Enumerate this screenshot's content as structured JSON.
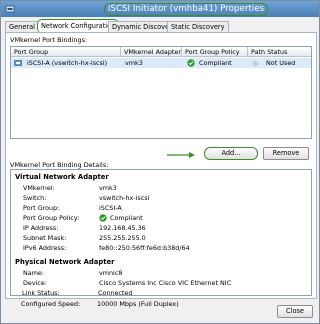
{
  "window": {
    "title": "iSCSI Initiator (vmhba41) Properties"
  },
  "tabs": [
    {
      "label": "General"
    },
    {
      "label": "Network Configuration"
    },
    {
      "label": "Dynamic Discovery"
    },
    {
      "label": "Static Discovery"
    }
  ],
  "bindings": {
    "section_label": "VMkernel Port Bindings:",
    "columns": [
      "Port Group",
      "VMkernel Adapter",
      "Port Group Policy",
      "Path Status"
    ],
    "rows": [
      {
        "port_group": "iSCSI-A (vswitch-hx-iscsi)",
        "vmkernel_adapter": "vmk3",
        "policy": "Compliant",
        "path_status": "Not Used"
      }
    ],
    "add_button": "Add...",
    "remove_button": "Remove"
  },
  "details": {
    "section_label": "VMkernel Port Binding Details:",
    "virtual": {
      "title": "Virtual Network Adapter",
      "fields": [
        {
          "label": "VMkernel:",
          "value": "vmk3"
        },
        {
          "label": "Switch:",
          "value": "vswitch-hx-iscsi"
        },
        {
          "label": "Port Group:",
          "value": "iSCSI-A"
        },
        {
          "label": "Port Group Policy:",
          "value": "Compliant"
        },
        {
          "label": "IP Address:",
          "value": "192.168.45.36"
        },
        {
          "label": "Subnet Mask:",
          "value": "255.255.255.0"
        },
        {
          "label": "IPv6 Address:",
          "value": "fe80::250:56ff:fe6d:b38d/64"
        }
      ]
    },
    "physical": {
      "title": "Physical Network Adapter",
      "fields": [
        {
          "label": "Name:",
          "value": "vmnic8"
        },
        {
          "label": "Device:",
          "value": "Cisco Systems Inc Cisco VIC Ethernet NIC"
        },
        {
          "label": "Link Status:",
          "value": "Connected"
        },
        {
          "label": "Configured Speed:",
          "value": "10000 Mbps (Full Duplex)"
        }
      ]
    }
  },
  "footer": {
    "close_button": "Close"
  },
  "colors": {
    "highlight": "#3d8b2c",
    "titlebar": "#5a8fc6",
    "selected_row": "#dce9f8",
    "compliant": "#2e9e2e"
  }
}
